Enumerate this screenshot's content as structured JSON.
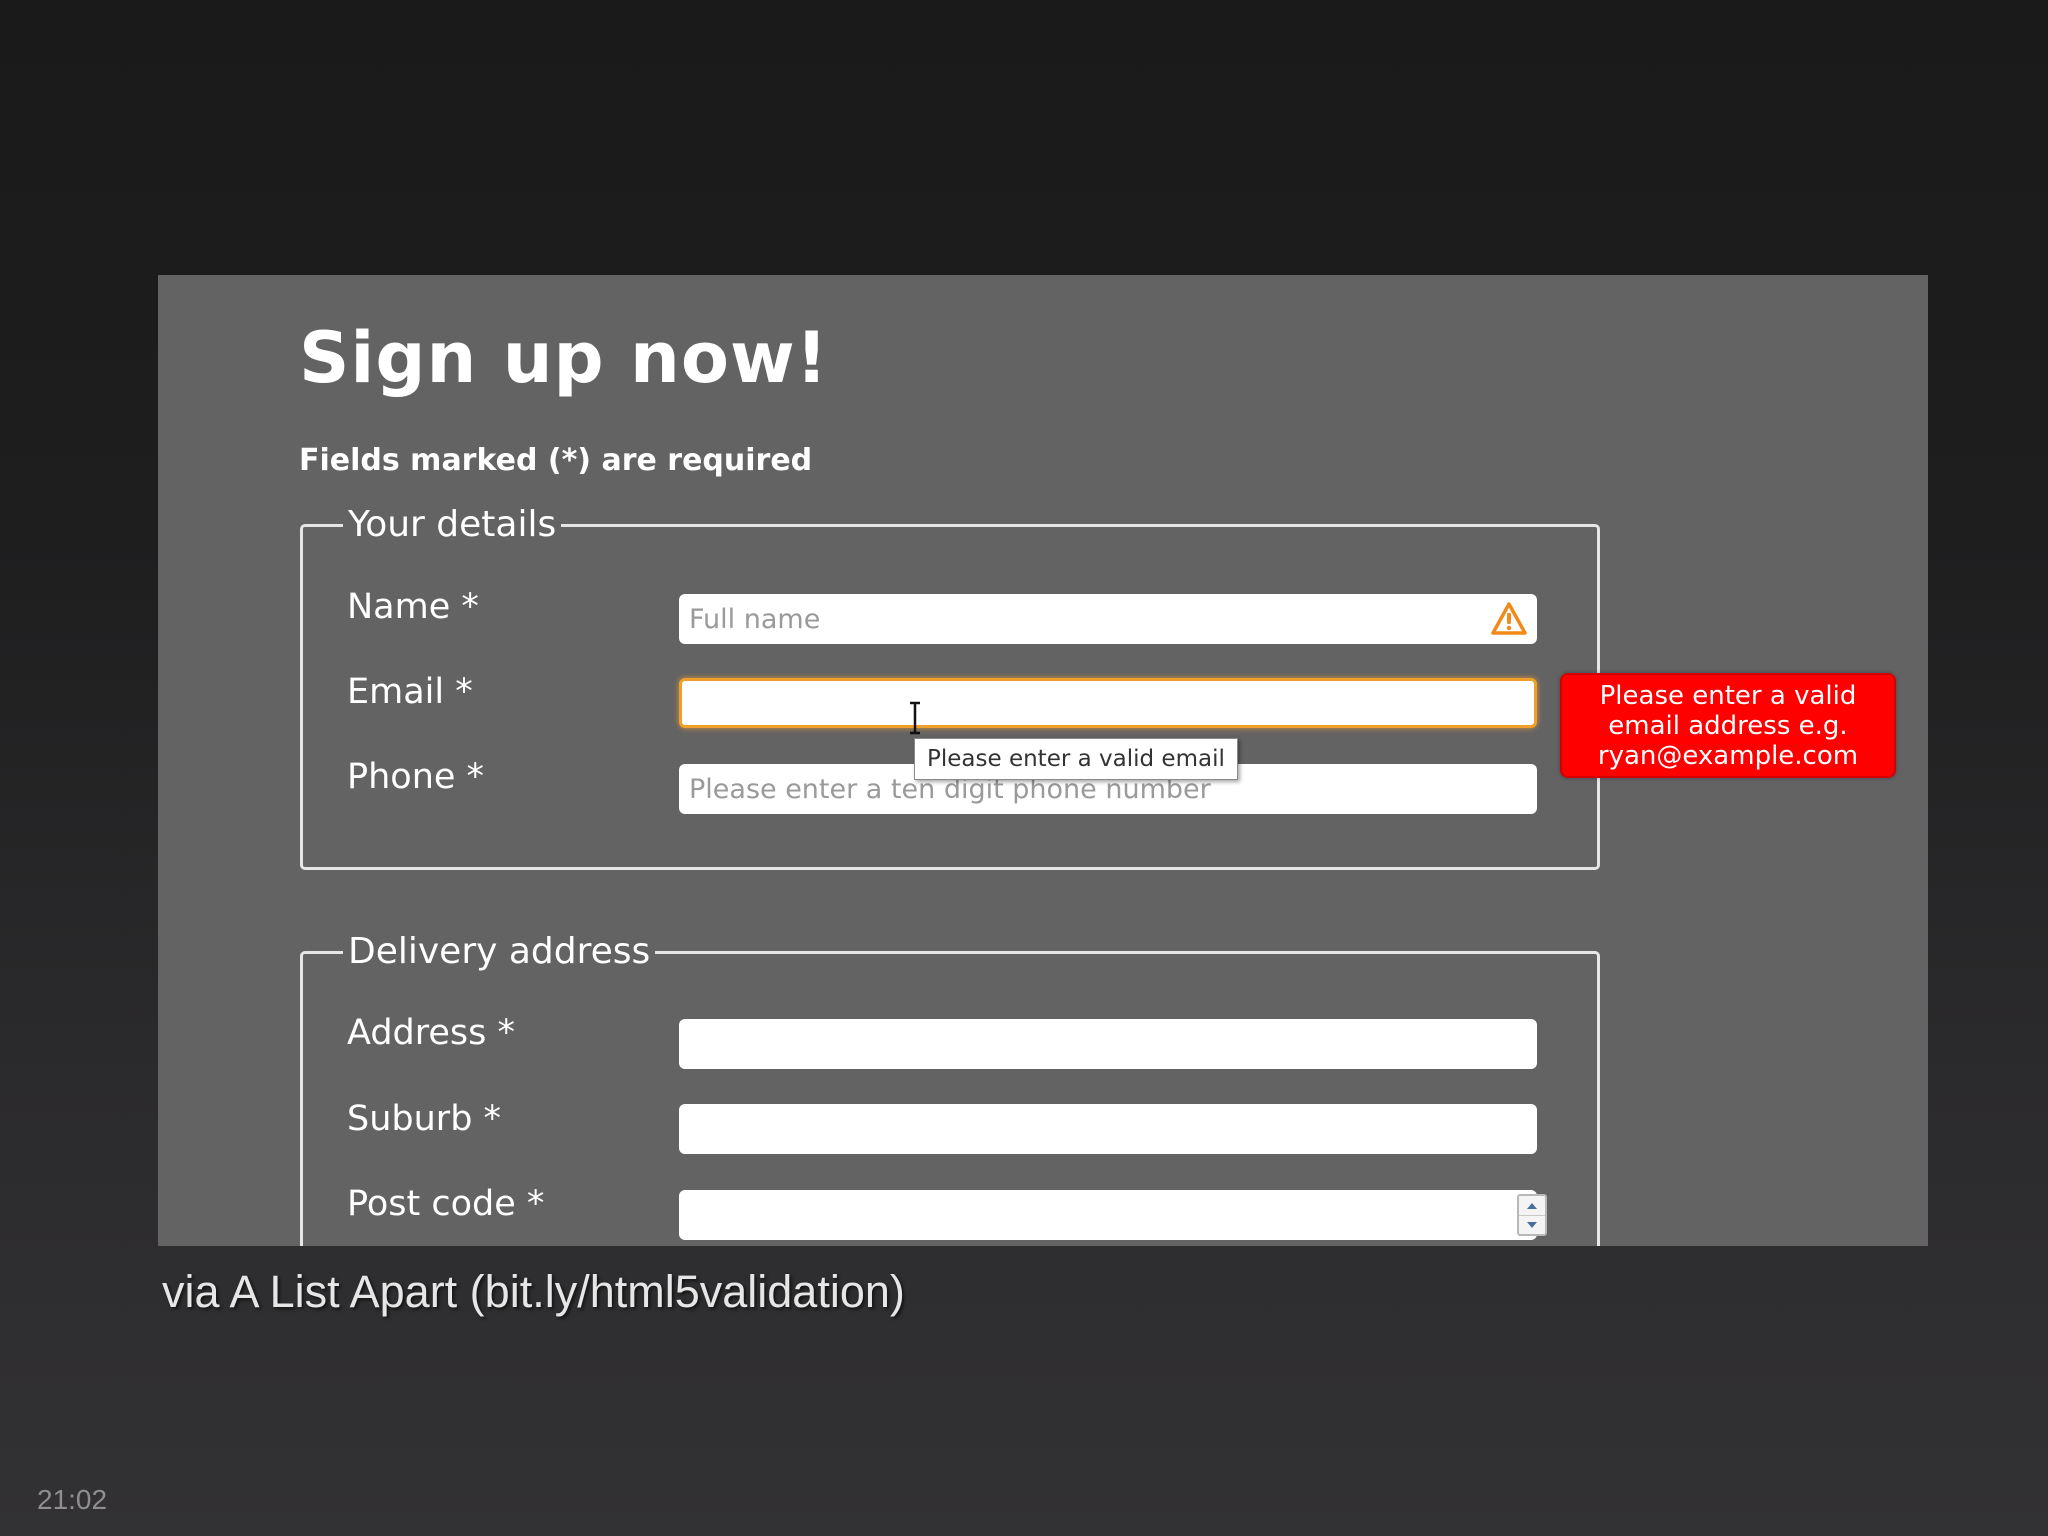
{
  "form": {
    "title": "Sign up now!",
    "required_note": "Fields marked (*) are required",
    "details": {
      "legend": "Your details",
      "name": {
        "label": "Name *",
        "placeholder": "Full name",
        "status_icon": "warning-triangle-icon"
      },
      "email": {
        "label": "Email *",
        "value": "",
        "placeholder": ""
      },
      "phone": {
        "label": "Phone *",
        "placeholder": "Please enter a ten digit phone number"
      }
    },
    "delivery": {
      "legend": "Delivery address",
      "address": {
        "label": "Address *",
        "value": ""
      },
      "suburb": {
        "label": "Suburb *",
        "value": ""
      },
      "postcode": {
        "label": "Post code *",
        "value": ""
      }
    }
  },
  "tooltip": {
    "text": "Please enter a valid email"
  },
  "error_bubble": {
    "lines": [
      "Please enter a valid",
      "email address e.g.",
      "ryan@example.com"
    ]
  },
  "caption": "via A List Apart (bit.ly/html5validation)",
  "timestamp": "21:02",
  "colors": {
    "panel": "#646364",
    "focus": "#f0a02a",
    "error": "#ff0000",
    "warning": "#f28a1a"
  }
}
